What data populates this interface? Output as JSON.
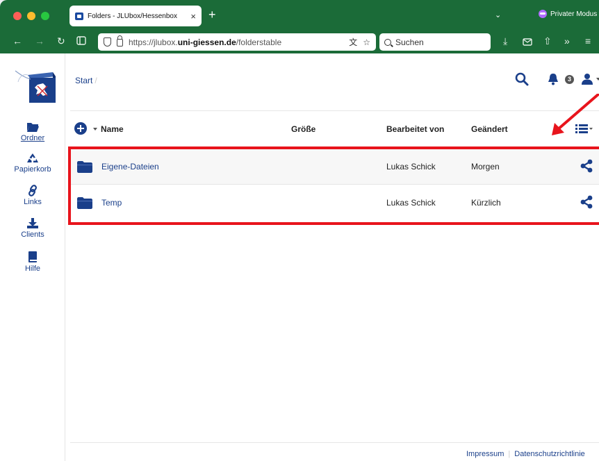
{
  "browser": {
    "tab_title": "Folders - JLUbox/Hessenbox",
    "tab_close": "×",
    "new_tab": "+",
    "private_mode": "Privater Modus",
    "url_prefix": "https://jlubox.",
    "url_domain": "uni-giessen.de",
    "url_path": "/folderstable",
    "search_placeholder": "Suchen"
  },
  "sidebar": {
    "items": [
      {
        "label": "Ordner",
        "icon": "folder-open-icon"
      },
      {
        "label": "Papierkorb",
        "icon": "recycle-icon"
      },
      {
        "label": "Links",
        "icon": "link-icon"
      },
      {
        "label": "Clients",
        "icon": "download-icon"
      },
      {
        "label": "Hilfe",
        "icon": "book-icon"
      }
    ]
  },
  "header": {
    "breadcrumb": "Start",
    "breadcrumb_sep": "/",
    "notifications_count": "3"
  },
  "table": {
    "columns": {
      "name": "Name",
      "size": "Größe",
      "edited_by": "Bearbeitet von",
      "modified": "Geändert"
    },
    "rows": [
      {
        "name": "Eigene-Dateien",
        "size": "",
        "edited_by": "Lukas Schick",
        "modified": "Morgen"
      },
      {
        "name": "Temp",
        "size": "",
        "edited_by": "Lukas Schick",
        "modified": "Kürzlich"
      }
    ]
  },
  "footer": {
    "impressum": "Impressum",
    "privacy": "Datenschutzrichtlinie"
  },
  "colors": {
    "browser_green": "#1b6b38",
    "brand_blue": "#1a3f8a",
    "highlight_red": "#e8141c"
  }
}
